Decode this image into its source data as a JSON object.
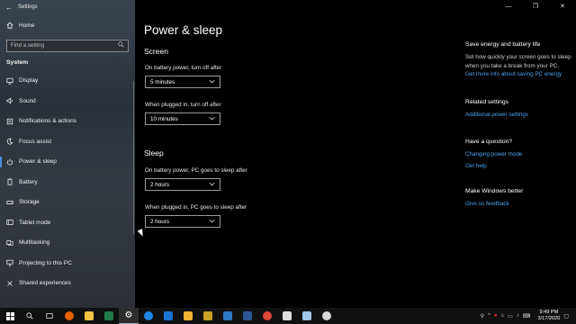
{
  "window": {
    "title": "Settings",
    "controls": [
      "—",
      "❐",
      "✕"
    ]
  },
  "sidebar": {
    "home_label": "Home",
    "search_placeholder": "Find a setting",
    "section_title": "System",
    "items": [
      {
        "label": "Display",
        "icon": "display-icon"
      },
      {
        "label": "Sound",
        "icon": "sound-icon"
      },
      {
        "label": "Notifications & actions",
        "icon": "notifications-icon"
      },
      {
        "label": "Focus assist",
        "icon": "focus-assist-icon"
      },
      {
        "label": "Power & sleep",
        "icon": "power-icon",
        "active": true
      },
      {
        "label": "Battery",
        "icon": "battery-icon"
      },
      {
        "label": "Storage",
        "icon": "storage-icon"
      },
      {
        "label": "Tablet mode",
        "icon": "tablet-icon"
      },
      {
        "label": "Multitasking",
        "icon": "multitasking-icon"
      },
      {
        "label": "Projecting to this PC",
        "icon": "projecting-icon"
      },
      {
        "label": "Shared experiences",
        "icon": "shared-icon"
      }
    ]
  },
  "main": {
    "title": "Power & sleep",
    "screen": {
      "heading": "Screen",
      "battery_label": "On battery power, turn off after",
      "battery_value": "5 minutes",
      "plugged_label": "When plugged in, turn off after",
      "plugged_value": "10 minutes"
    },
    "sleep": {
      "heading": "Sleep",
      "battery_label": "On battery power, PC goes to sleep after",
      "battery_value": "2 hours",
      "plugged_label": "When plugged in, PC goes to sleep after",
      "plugged_value": "2 hours"
    }
  },
  "right": {
    "save_heading": "Save energy and battery life",
    "save_text": "Set how quickly your screen goes to sleep when you take a break from your PC.",
    "save_link": "Get more info about saving PC energy",
    "related_heading": "Related settings",
    "related_link": "Additional power settings",
    "question_heading": "Have a question?",
    "question_link1": "Changing power mode",
    "question_link2": "Get help",
    "better_heading": "Make Windows better",
    "better_link": "Give us feedback"
  },
  "taskbar": {
    "time": "9:49 PM",
    "date": "3/17/2020",
    "colors": {
      "accent": "#4aa3ef",
      "sidebar_active": "#4a90e2"
    }
  }
}
